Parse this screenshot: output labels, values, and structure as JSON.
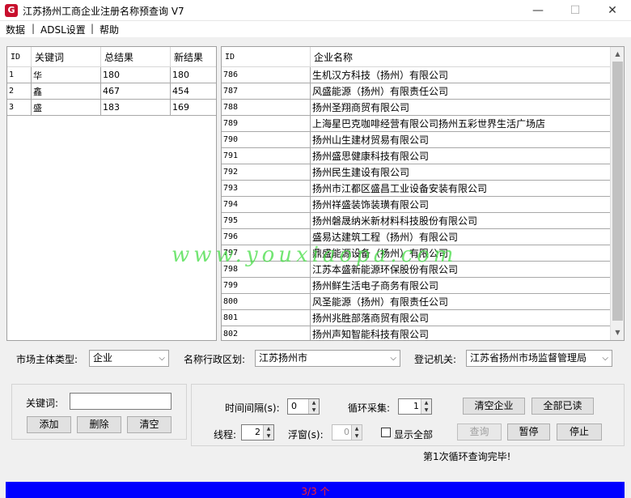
{
  "window": {
    "title": "江苏扬州工商企业注册名称预查询 V7",
    "app_icon_letter": "G",
    "minimize_glyph": "—",
    "maximize_glyph": "☐",
    "close_glyph": "✕"
  },
  "menu": {
    "items": [
      "数据",
      "ADSL设置",
      "帮助"
    ],
    "separator": "|"
  },
  "keyword_table": {
    "headers": [
      "ID",
      "关键词",
      "总结果",
      "新结果"
    ],
    "rows": [
      [
        "1",
        "华",
        "180",
        "180"
      ],
      [
        "2",
        "鑫",
        "467",
        "454"
      ],
      [
        "3",
        "盛",
        "183",
        "169"
      ]
    ]
  },
  "result_table": {
    "headers": [
      "ID",
      "企业名称"
    ],
    "rows": [
      [
        "786",
        "生机汉方科技（扬州）有限公司"
      ],
      [
        "787",
        "风盛能源（扬州）有限责任公司"
      ],
      [
        "788",
        "扬州圣翔商贸有限公司"
      ],
      [
        "789",
        "上海星巴克咖啡经营有限公司扬州五彩世界生活广场店"
      ],
      [
        "790",
        "扬州山生建材贸易有限公司"
      ],
      [
        "791",
        "扬州盛思健康科技有限公司"
      ],
      [
        "792",
        "扬州民生建设有限公司"
      ],
      [
        "793",
        "扬州市江都区盛昌工业设备安装有限公司"
      ],
      [
        "794",
        "扬州祥盛装饰装璜有限公司"
      ],
      [
        "795",
        "扬州磐晟纳米新材料科技股份有限公司"
      ],
      [
        "796",
        "盛易达建筑工程（扬州）有限公司"
      ],
      [
        "797",
        "鼎盛能源设备（扬州）有限公司"
      ],
      [
        "798",
        "江苏本盛新能源环保股份有限公司"
      ],
      [
        "799",
        "扬州鲜生活电子商务有限公司"
      ],
      [
        "800",
        "风圣能源（扬州）有限责任公司"
      ],
      [
        "801",
        "扬州兆胜部落商贸有限公司"
      ],
      [
        "802",
        "扬州声知智能科技有限公司"
      ]
    ],
    "scroll_up_glyph": "▲",
    "scroll_down_glyph": "▼"
  },
  "filters": {
    "market_type_label": "市场主体类型:",
    "market_type_value": "企业",
    "region_label": "名称行政区划:",
    "region_value": "江苏扬州市",
    "registry_label": "登记机关:",
    "registry_value": "江苏省扬州市场监督管理局",
    "dropdown_glyph": "⌵"
  },
  "keyword_panel": {
    "label": "关键词:",
    "input_value": "",
    "add_label": "添加",
    "delete_label": "删除",
    "clear_label": "清空"
  },
  "controls": {
    "interval_label": "时间间隔(s):",
    "interval_value": "0",
    "loop_label": "循环采集:",
    "loop_value": "1",
    "threads_label": "线程:",
    "threads_value": "2",
    "float_label": "浮窗(s):",
    "float_value": "0",
    "show_all_label": "显示全部",
    "show_all_checked": false,
    "clear_companies_label": "清空企业",
    "mark_all_read_label": "全部已读",
    "query_label": "查询",
    "pause_label": "暂停",
    "stop_label": "停止",
    "spin_up_glyph": "▲",
    "spin_down_glyph": "▼"
  },
  "status": {
    "message": "第1次循环查询完毕!",
    "progress_text": "3/3 个",
    "progress_fraction": 1.0,
    "bar_color": "#0000ff"
  },
  "watermark": "www.youxiaopa.com"
}
